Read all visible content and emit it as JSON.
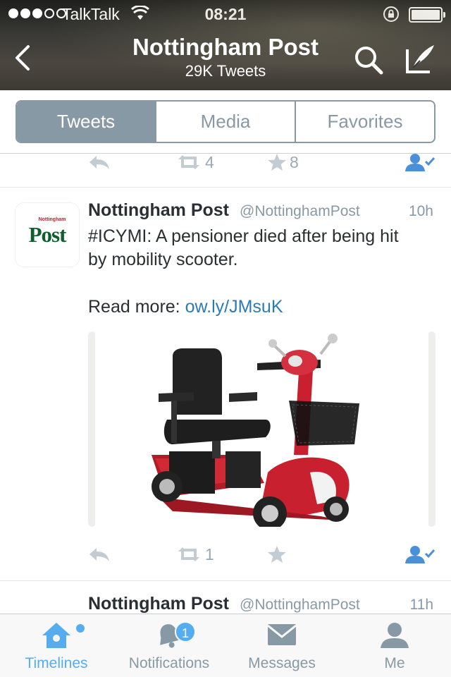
{
  "status_bar": {
    "carrier": "TalkTalk",
    "time": "08:21"
  },
  "header": {
    "title": "Nottingham Post",
    "subtitle": "29K Tweets"
  },
  "segments": {
    "tweets": "Tweets",
    "media": "Media",
    "favorites": "Favorites",
    "selected": "Tweets"
  },
  "previous_tweet": {
    "retweets": "4",
    "favorites": "8"
  },
  "tweets": [
    {
      "name": "Nottingham Post",
      "handle": "@NottinghamPost",
      "time": "10h",
      "text_line1": "#ICYMI: A pensioner died after being hit",
      "text_line2": "by mobility scooter.",
      "read_more_label": "Read more:",
      "link": "ow.ly/JMsuK",
      "retweets": "1",
      "avatar_logo": "Post",
      "avatar_logo_small": "Nottingham"
    },
    {
      "name": "Nottingham Post",
      "handle": "@NottinghamPost",
      "time": "11h"
    }
  ],
  "tabbar": {
    "timelines": "Timelines",
    "notifications": "Notifications",
    "notifications_badge": "1",
    "messages": "Messages",
    "me": "Me",
    "active": "Timelines"
  },
  "colors": {
    "accent": "#55acee",
    "gray": "#8899a6",
    "brand_green": "#0d5f2e",
    "scooter_red": "#c8202e"
  },
  "icons": [
    "back-icon",
    "search-icon",
    "compose-icon",
    "reply-icon",
    "retweet-icon",
    "star-icon",
    "follow-user-icon",
    "home-icon",
    "bell-icon",
    "envelope-icon",
    "person-icon"
  ]
}
